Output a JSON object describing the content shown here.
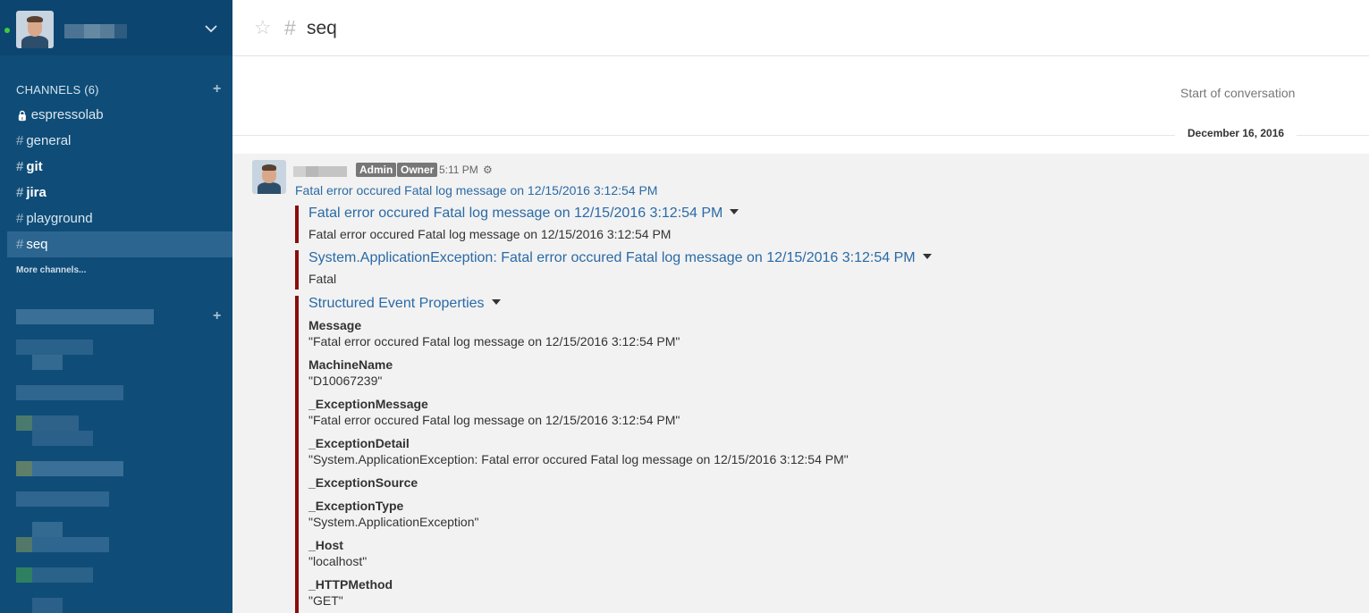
{
  "sidebar": {
    "channels_header": "CHANNELS (6)",
    "add_glyph": "+",
    "channels": [
      {
        "name": "espressolab",
        "icon": "lock-icon",
        "glyph": "🔒",
        "bold": false,
        "active": false
      },
      {
        "name": "general",
        "icon": "hash-icon",
        "glyph": "#",
        "bold": false,
        "active": false
      },
      {
        "name": "git",
        "icon": "hash-icon",
        "glyph": "#",
        "bold": true,
        "active": false
      },
      {
        "name": "jira",
        "icon": "hash-icon",
        "glyph": "#",
        "bold": true,
        "active": false
      },
      {
        "name": "playground",
        "icon": "hash-icon",
        "glyph": "#",
        "bold": false,
        "active": false
      },
      {
        "name": "seq",
        "icon": "hash-icon",
        "glyph": "#",
        "bold": false,
        "active": true
      }
    ],
    "more_channels": "More channels...",
    "status_color": "#3fca3f"
  },
  "header": {
    "channel_name": "seq",
    "star_glyph": "☆",
    "hash_glyph": "#"
  },
  "conversation": {
    "start_label": "Start of conversation",
    "date_label": "December 16, 2016"
  },
  "post": {
    "badges": [
      "Admin",
      "Owner"
    ],
    "time": "5:11 PM",
    "gear_glyph": "⚙",
    "text": "Fatal error occured Fatal log message on 12/15/2016 3:12:54 PM",
    "attachments": [
      {
        "title": "Fatal error occured Fatal log message on 12/15/2016 3:12:54 PM",
        "text": "Fatal error occured Fatal log message on 12/15/2016 3:12:54 PM"
      },
      {
        "title": "System.ApplicationException: Fatal error occured Fatal log message on 12/15/2016 3:12:54 PM",
        "text": "Fatal"
      },
      {
        "title": "Structured Event Properties",
        "fields": [
          {
            "name": "Message",
            "value": "\"Fatal error occured Fatal log message on 12/15/2016 3:12:54 PM\""
          },
          {
            "name": "MachineName",
            "value": "\"D10067239\""
          },
          {
            "name": "_ExceptionMessage",
            "value": "\"Fatal error occured Fatal log message on 12/15/2016 3:12:54 PM\""
          },
          {
            "name": "_ExceptionDetail",
            "value": "\"System.ApplicationException: Fatal error occured Fatal log message on 12/15/2016 3:12:54 PM\""
          },
          {
            "name": "_ExceptionSource",
            "value": ""
          },
          {
            "name": "_ExceptionType",
            "value": "\"System.ApplicationException\""
          },
          {
            "name": "_Host",
            "value": "\"localhost\""
          },
          {
            "name": "_HTTPMethod",
            "value": "\"GET\""
          }
        ]
      }
    ]
  },
  "colors": {
    "sidebar_bg": "#0f4d78",
    "accent_link": "#2a6aa6",
    "attachment_bar": "#8b0d0d",
    "badge_bg": "#777777"
  }
}
